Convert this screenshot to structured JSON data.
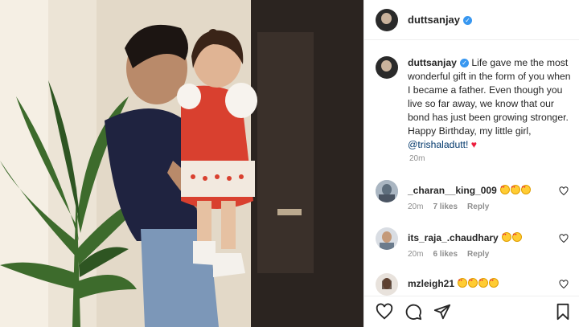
{
  "post": {
    "username": "duttsanjay",
    "verified_glyph": "✓",
    "caption_text": "Life gave me the most wonderful gift in the form of you when I became a father. Even though you live so far away, we know that our bond has just been growing stronger. Happy Birthday, my little girl, ",
    "caption_mention": "@trishaladutt!",
    "caption_heart": "♥",
    "time": "20m"
  },
  "comments": [
    {
      "username": "_charan__king_009",
      "emoji_count": 3,
      "time": "20m",
      "likes": "7 likes",
      "reply": "Reply"
    },
    {
      "username": "its_raja_.chaudhary",
      "emoji_count": 2,
      "time": "20m",
      "likes": "6 likes",
      "reply": "Reply"
    },
    {
      "username": "mzleigh21",
      "emoji_count": 4
    }
  ],
  "icons": {
    "like": "heart-icon",
    "comment": "comment-icon",
    "share": "send-icon",
    "save": "bookmark-icon"
  },
  "colors": {
    "verified": "#3897f0",
    "mention": "#00376b",
    "heart": "#ed1c3c",
    "meta": "#8e8e8e"
  }
}
